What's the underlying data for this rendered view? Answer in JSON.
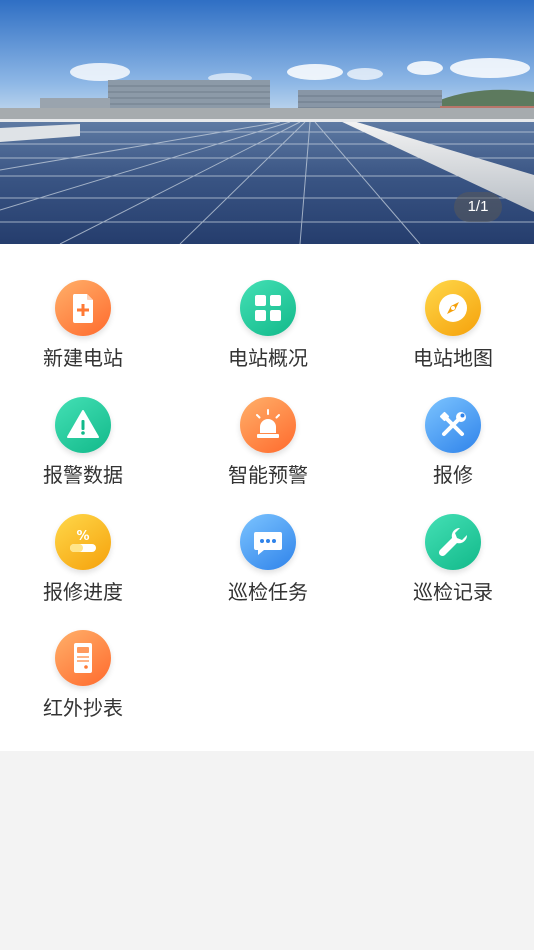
{
  "banner": {
    "pager": "1/1"
  },
  "menu": {
    "items": [
      {
        "label": "新建电站",
        "icon": "new-document-icon",
        "color": "#ff7a35"
      },
      {
        "label": "电站概况",
        "icon": "grid-icon",
        "color": "#1cc795"
      },
      {
        "label": "电站地图",
        "icon": "compass-icon",
        "color": "#f7b020"
      },
      {
        "label": "报警数据",
        "icon": "warning-icon",
        "color": "#1cc795"
      },
      {
        "label": "智能预警",
        "icon": "alarm-light-icon",
        "color": "#ff7a35"
      },
      {
        "label": "报修",
        "icon": "tools-icon",
        "color": "#3f92f0"
      },
      {
        "label": "报修进度",
        "icon": "progress-icon",
        "color": "#f7b020"
      },
      {
        "label": "巡检任务",
        "icon": "chat-icon",
        "color": "#3f92f0"
      },
      {
        "label": "巡检记录",
        "icon": "wrench-icon",
        "color": "#1cc795"
      },
      {
        "label": "红外抄表",
        "icon": "meter-icon",
        "color": "#ff7a35"
      }
    ]
  }
}
